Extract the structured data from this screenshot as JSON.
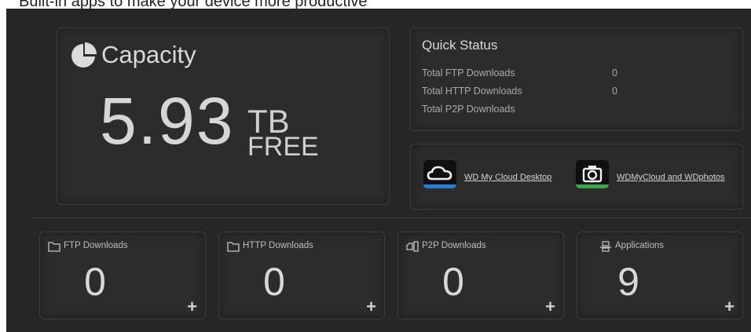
{
  "caption": "Built-in apps to make your device more productive",
  "capacity": {
    "label": "Capacity",
    "value": "5.93",
    "unit": "TB",
    "suffix": "FREE"
  },
  "quick_status": {
    "title": "Quick Status",
    "rows": [
      {
        "label": "Total FTP Downloads",
        "value": "0"
      },
      {
        "label": "Total HTTP Downloads",
        "value": "0"
      },
      {
        "label": "Total P2P Downloads",
        "value": ""
      }
    ]
  },
  "apps": [
    {
      "label": "WD My Cloud Desktop",
      "icon": "cloud-icon",
      "glow": "#2a7fd4"
    },
    {
      "label": "WDMyCloud and WDphotos",
      "icon": "camera-icon",
      "glow": "#3aa84a"
    }
  ],
  "stats": [
    {
      "label": "FTP Downloads",
      "value": "0",
      "icon": "folder-icon"
    },
    {
      "label": "HTTP Downloads",
      "value": "0",
      "icon": "folder-icon"
    },
    {
      "label": "P2P Downloads",
      "value": "0",
      "icon": "p2p-icon"
    },
    {
      "label": "Applications",
      "value": "9",
      "icon": "applications-icon"
    }
  ],
  "plus_symbol": "+"
}
